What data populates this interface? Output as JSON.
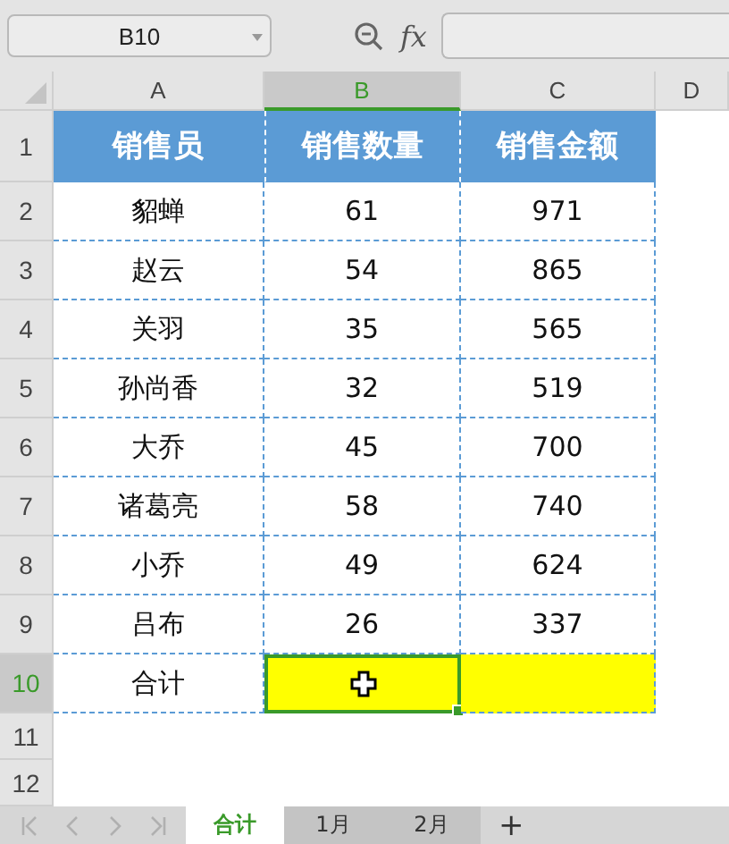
{
  "name_box": {
    "value": "B10"
  },
  "formula_bar": {
    "function_label": "fx"
  },
  "columns": [
    {
      "label": "A",
      "selected": false
    },
    {
      "label": "B",
      "selected": true
    },
    {
      "label": "C",
      "selected": false
    },
    {
      "label": "D",
      "selected": false
    }
  ],
  "rows": [
    {
      "number": "1",
      "selected": false,
      "kind": "header",
      "cells": [
        {
          "text": "销售员"
        },
        {
          "text": "销售数量"
        },
        {
          "text": "销售金额"
        }
      ]
    },
    {
      "number": "2",
      "selected": false,
      "kind": "data",
      "cells": [
        {
          "text": "貂蝉"
        },
        {
          "text": "61"
        },
        {
          "text": "971"
        }
      ]
    },
    {
      "number": "3",
      "selected": false,
      "kind": "data",
      "cells": [
        {
          "text": "赵云"
        },
        {
          "text": "54"
        },
        {
          "text": "865"
        }
      ]
    },
    {
      "number": "4",
      "selected": false,
      "kind": "data",
      "cells": [
        {
          "text": "关羽"
        },
        {
          "text": "35"
        },
        {
          "text": "565"
        }
      ]
    },
    {
      "number": "5",
      "selected": false,
      "kind": "data",
      "cells": [
        {
          "text": "孙尚香"
        },
        {
          "text": "32"
        },
        {
          "text": "519"
        }
      ]
    },
    {
      "number": "6",
      "selected": false,
      "kind": "data",
      "cells": [
        {
          "text": "大乔"
        },
        {
          "text": "45"
        },
        {
          "text": "700"
        }
      ]
    },
    {
      "number": "7",
      "selected": false,
      "kind": "data",
      "cells": [
        {
          "text": "诸葛亮"
        },
        {
          "text": "58"
        },
        {
          "text": "740"
        }
      ]
    },
    {
      "number": "8",
      "selected": false,
      "kind": "data",
      "cells": [
        {
          "text": "小乔"
        },
        {
          "text": "49"
        },
        {
          "text": "624"
        }
      ]
    },
    {
      "number": "9",
      "selected": false,
      "kind": "data",
      "cells": [
        {
          "text": "吕布"
        },
        {
          "text": "26"
        },
        {
          "text": "337"
        }
      ]
    },
    {
      "number": "10",
      "selected": true,
      "kind": "data",
      "cells": [
        {
          "text": "合计",
          "highlighted": false,
          "selected": false
        },
        {
          "highlighted": true,
          "selected": true
        },
        {
          "highlighted": true,
          "selected": false
        }
      ]
    },
    {
      "number": "11",
      "selected": false
    },
    {
      "number": "12",
      "selected": false
    }
  ],
  "sheet_tabs": [
    {
      "label": "合计",
      "selected": true
    },
    {
      "label": "1月",
      "selected": false
    },
    {
      "label": "2月",
      "selected": false
    }
  ],
  "add_sheet": {
    "label": "+"
  }
}
